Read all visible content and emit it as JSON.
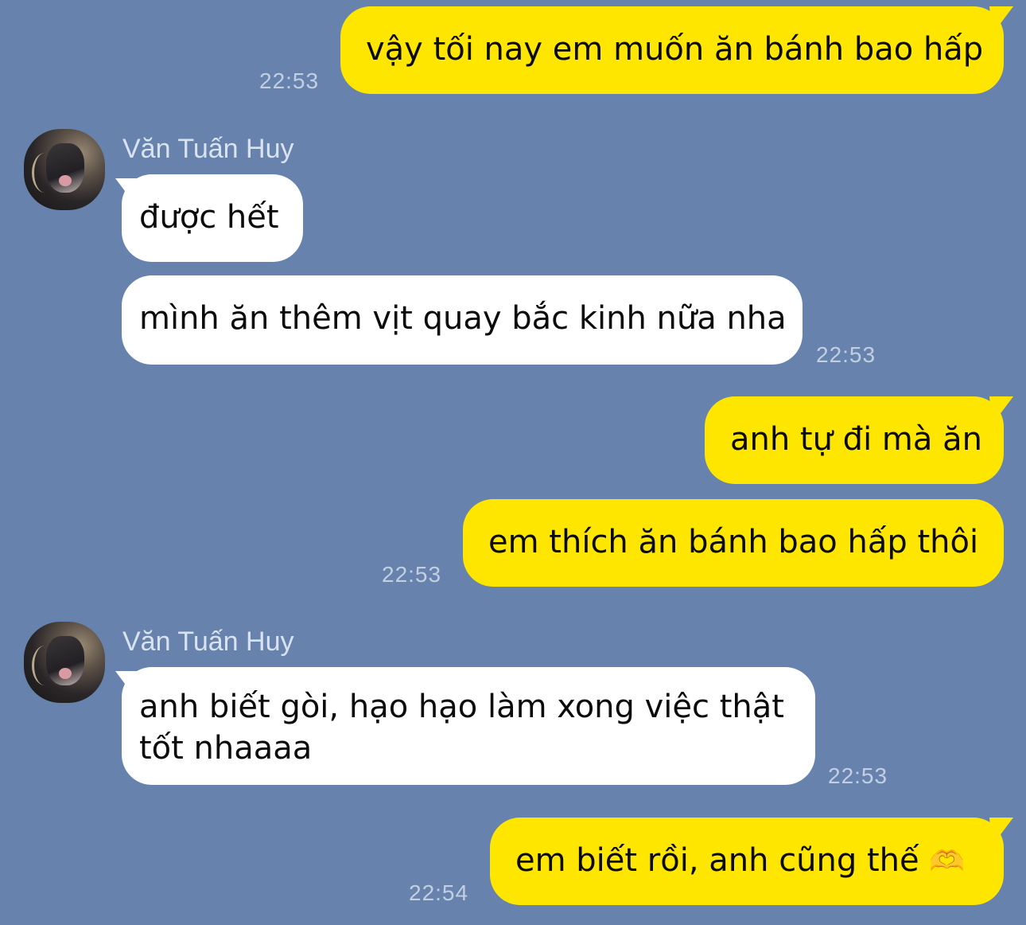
{
  "chat": {
    "colors": {
      "background": "#6783ad",
      "outgoing_bubble": "#ffe600",
      "incoming_bubble": "#ffffff",
      "timestamp": "#c2cfe3",
      "sender_name": "#d9e2ef"
    },
    "messages": [
      {
        "id": 1,
        "direction": "outgoing",
        "text": "vậy tối nay em muốn ăn bánh bao hấp",
        "time": "22:53"
      },
      {
        "id": 2,
        "direction": "incoming",
        "sender": "Văn Tuấn Huy",
        "avatar_icon": "cat-avatar-icon",
        "text": "được hết"
      },
      {
        "id": 3,
        "direction": "incoming",
        "text": "mình ăn thêm vịt quay bắc kinh nữa nha",
        "time": "22:53"
      },
      {
        "id": 4,
        "direction": "outgoing",
        "text": "anh tự đi mà ăn"
      },
      {
        "id": 5,
        "direction": "outgoing",
        "text": "em thích ăn bánh bao hấp thôi",
        "time": "22:53"
      },
      {
        "id": 6,
        "direction": "incoming",
        "sender": "Văn Tuấn Huy",
        "avatar_icon": "cat-avatar-icon",
        "text": "anh biết gòi, hạo hạo làm xong việc thật tốt nhaaaa",
        "time": "22:53"
      },
      {
        "id": 7,
        "direction": "outgoing",
        "text": "em biết rồi, anh cũng thế",
        "emoji": "🫶",
        "emoji_icon": "heart-hands-emoji-icon",
        "time": "22:54"
      }
    ]
  }
}
